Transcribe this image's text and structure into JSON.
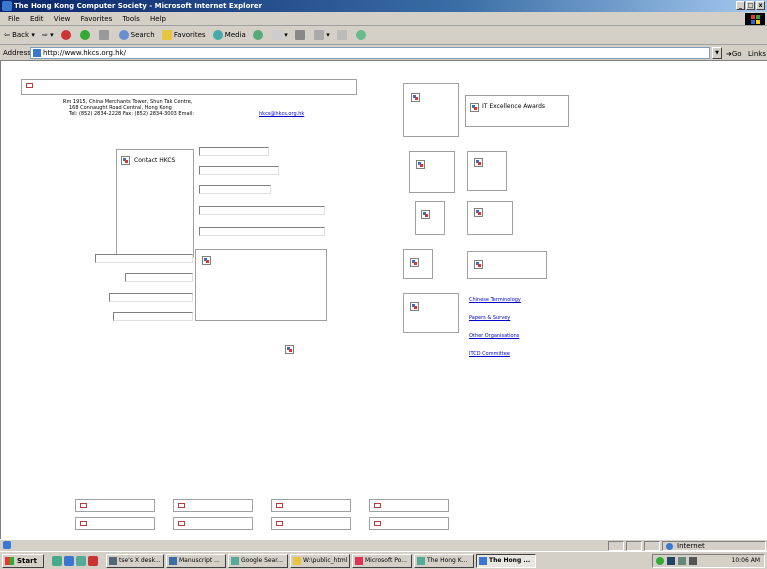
{
  "window": {
    "title": "The Hong Kong Computer Society - Microsoft Internet Explorer",
    "controls": [
      "_",
      "□",
      "x"
    ]
  },
  "menu": [
    "File",
    "Edit",
    "View",
    "Favorites",
    "Tools",
    "Help"
  ],
  "toolbar": {
    "back": "Back",
    "search": "Search",
    "favorites": "Favorites",
    "media": "Media"
  },
  "address": {
    "label": "Address",
    "url": "http://www.hkcs.org.hk/",
    "go": "Go",
    "links": "Links"
  },
  "page": {
    "address_lines": [
      "Rm 1915, China Merchants Tower, Shun Tak Centre,",
      "168 Connaught Road Central, Hong Kong",
      "Tel: (852) 2834-2228    Fax: (852) 2834-3003    Email:"
    ],
    "email": "hkcs@hkcs.org.hk",
    "contact_label": "Contact HKCS",
    "awards_label": "IT Excellence Awards",
    "links": [
      "Chinese Terminology",
      "Papers & Survey",
      "Other Organisations",
      "ITCD Committee"
    ]
  },
  "statusbar": {
    "zone": "Internet"
  },
  "taskbar": {
    "start": "Start",
    "tasks": [
      "tse's X desk...",
      "Manuscript ...",
      "Google Sear...",
      "W:\\public_html",
      "Microsoft Po...",
      "The Hong K...",
      "The Hong ..."
    ],
    "clock": "10:06 AM"
  }
}
